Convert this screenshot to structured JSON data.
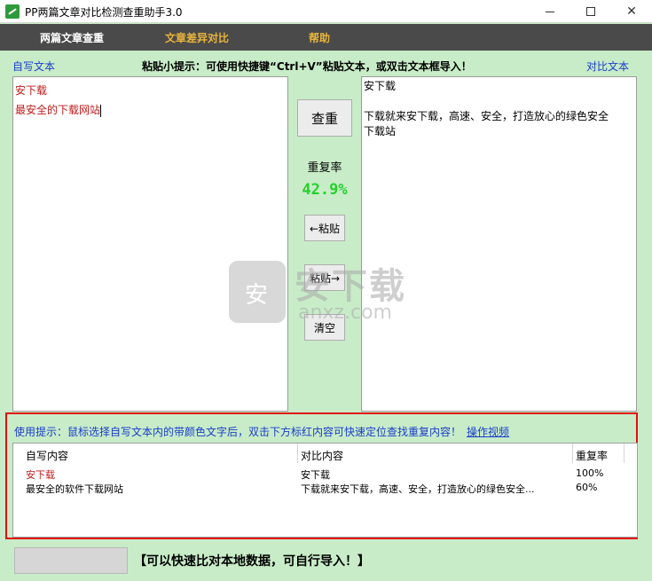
{
  "window": {
    "title": "PP两篇文章对比检测查重助手3.0",
    "minimize": "—",
    "maximize": "☐",
    "close": "✕"
  },
  "menu": {
    "items": [
      "两篇文章查重",
      "文章差异对比",
      "帮助"
    ],
    "active_color": "#e8b43a"
  },
  "labels": {
    "left": "自写文本",
    "right": "对比文本",
    "paste_tip": "粘贴小提示：可使用快捷键“Ctrl+V”粘贴文本，或双击文本框导入！"
  },
  "left_text": {
    "lines": [
      "安下载",
      "最安全的下载网站"
    ]
  },
  "right_text": {
    "lines": [
      "安下载",
      "",
      "下载就来安下载，高速、安全，打造放心的绿色安全",
      "下载站"
    ]
  },
  "controls": {
    "check_button": "查重",
    "rate_label": "重复率",
    "rate_value": "42.9%",
    "paste_left_button": "←粘贴",
    "paste_right_button": "粘贴→",
    "clear_button": "清空"
  },
  "watermark": {
    "text": "安下载",
    "sub": "anxz.com"
  },
  "results": {
    "usage_tip": "使用提示：鼠标选择自写文本内的带颜色文字后，双击下方标红内容可快速定位查找重复内容！",
    "usage_link": "操作视频",
    "columns": [
      "自写内容",
      "对比内容",
      "重复率"
    ],
    "rows": [
      {
        "own": "安下载",
        "compare": "安下载",
        "rate": "100%",
        "highlight": true
      },
      {
        "own": "最安全的软件下载网站",
        "compare": "下载就来安下载，高速、安全，打造放心的绿色安全...",
        "rate": "60%",
        "highlight": false
      }
    ]
  },
  "bottom": {
    "note": "【可以快速比对本地数据，可自行导入！】"
  }
}
